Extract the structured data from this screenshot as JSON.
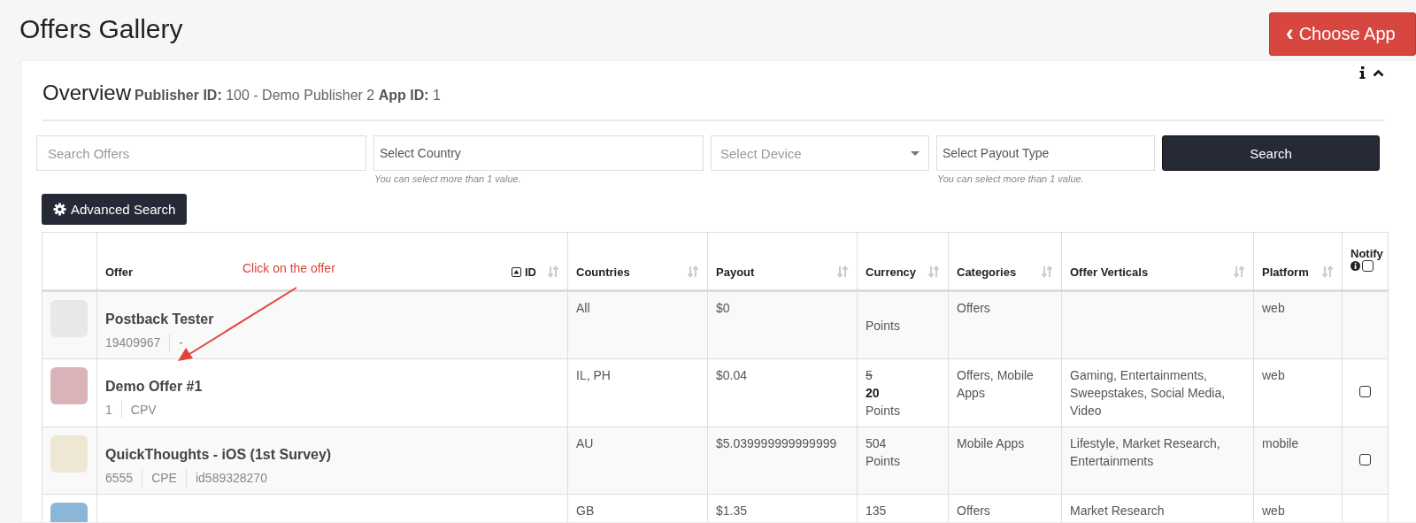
{
  "page_title": "Offers Gallery",
  "choose_app_button": {
    "icon": "‹",
    "label": "Choose App"
  },
  "panel": {
    "title": "Overview",
    "subtitle": "**Publisher ID:** 100 - Demo Publisher 2 **App ID:** 1"
  },
  "filters": [
    {
      "kind": "text",
      "placeholder": "Search Offers"
    },
    {
      "kind": "multi",
      "placeholder": "Select Country",
      "hint": "You can select more than 1 value."
    },
    {
      "kind": "select",
      "placeholder": "Select Device"
    },
    {
      "kind": "multi",
      "placeholder": "Select Payout Type",
      "hint": "You can select more than 1 value."
    }
  ],
  "search_button": "Search",
  "advanced_search_button": "Advanced Search",
  "annotation": {
    "text": "Click on the offer"
  },
  "table": {
    "columns": [
      {
        "label": "Offer",
        "sortable": false
      },
      {
        "label": "ID",
        "sortable": true
      },
      {
        "label": "Countries",
        "sortable": true
      },
      {
        "label": "Payout",
        "sortable": true
      },
      {
        "label": "Currency",
        "sortable": true
      },
      {
        "label": "Categories",
        "sortable": true
      },
      {
        "label": "Offer Verticals",
        "sortable": true
      },
      {
        "label": "Platform",
        "sortable": true
      },
      {
        "label": "Notify",
        "sortable": false
      }
    ],
    "notify_all_checked": false,
    "rows": [
      {
        "name": "Postback Tester",
        "meta": [
          "19409967",
          "-"
        ],
        "countries": "All",
        "payout": "$0",
        "currency": [
          {
            "text": "Points",
            "kind": "plain"
          }
        ],
        "categories": "Offers",
        "platform": "web"
      },
      {
        "name": "Demo Offer #1",
        "meta": [
          "1",
          "CPV"
        ],
        "countries": "IL, PH",
        "payout": "$0.04",
        "currency": [
          {
            "text": "5",
            "kind": "struck"
          },
          {
            "text": "20",
            "kind": "bold"
          },
          {
            "text": "Points",
            "kind": "plain"
          }
        ],
        "categories": "Offers, Mobile Apps",
        "verticals": "Gaming, Entertainments, Sweepstakes, Social Media, Video",
        "platform": "web",
        "notify": {
          "checked": false
        }
      },
      {
        "name": "QuickThoughts - iOS (1st Survey)",
        "meta": [
          "6555",
          "CPE",
          "id589328270"
        ],
        "countries": "AU",
        "payout": "$5.039999999999999",
        "currency": [
          {
            "text": "504",
            "kind": "plain"
          },
          {
            "text": "Points",
            "kind": "plain"
          }
        ],
        "categories": "Mobile Apps",
        "verticals": "Lifestyle, Market Research, Entertainments",
        "platform": "mobile",
        "notify": {
          "checked": false
        }
      },
      {
        "countries": "GB",
        "payout": "$1.35",
        "currency": [
          {
            "text": "135",
            "kind": "plain"
          }
        ],
        "categories": "Offers",
        "verticals": "Market Research",
        "platform": "web"
      }
    ]
  }
}
